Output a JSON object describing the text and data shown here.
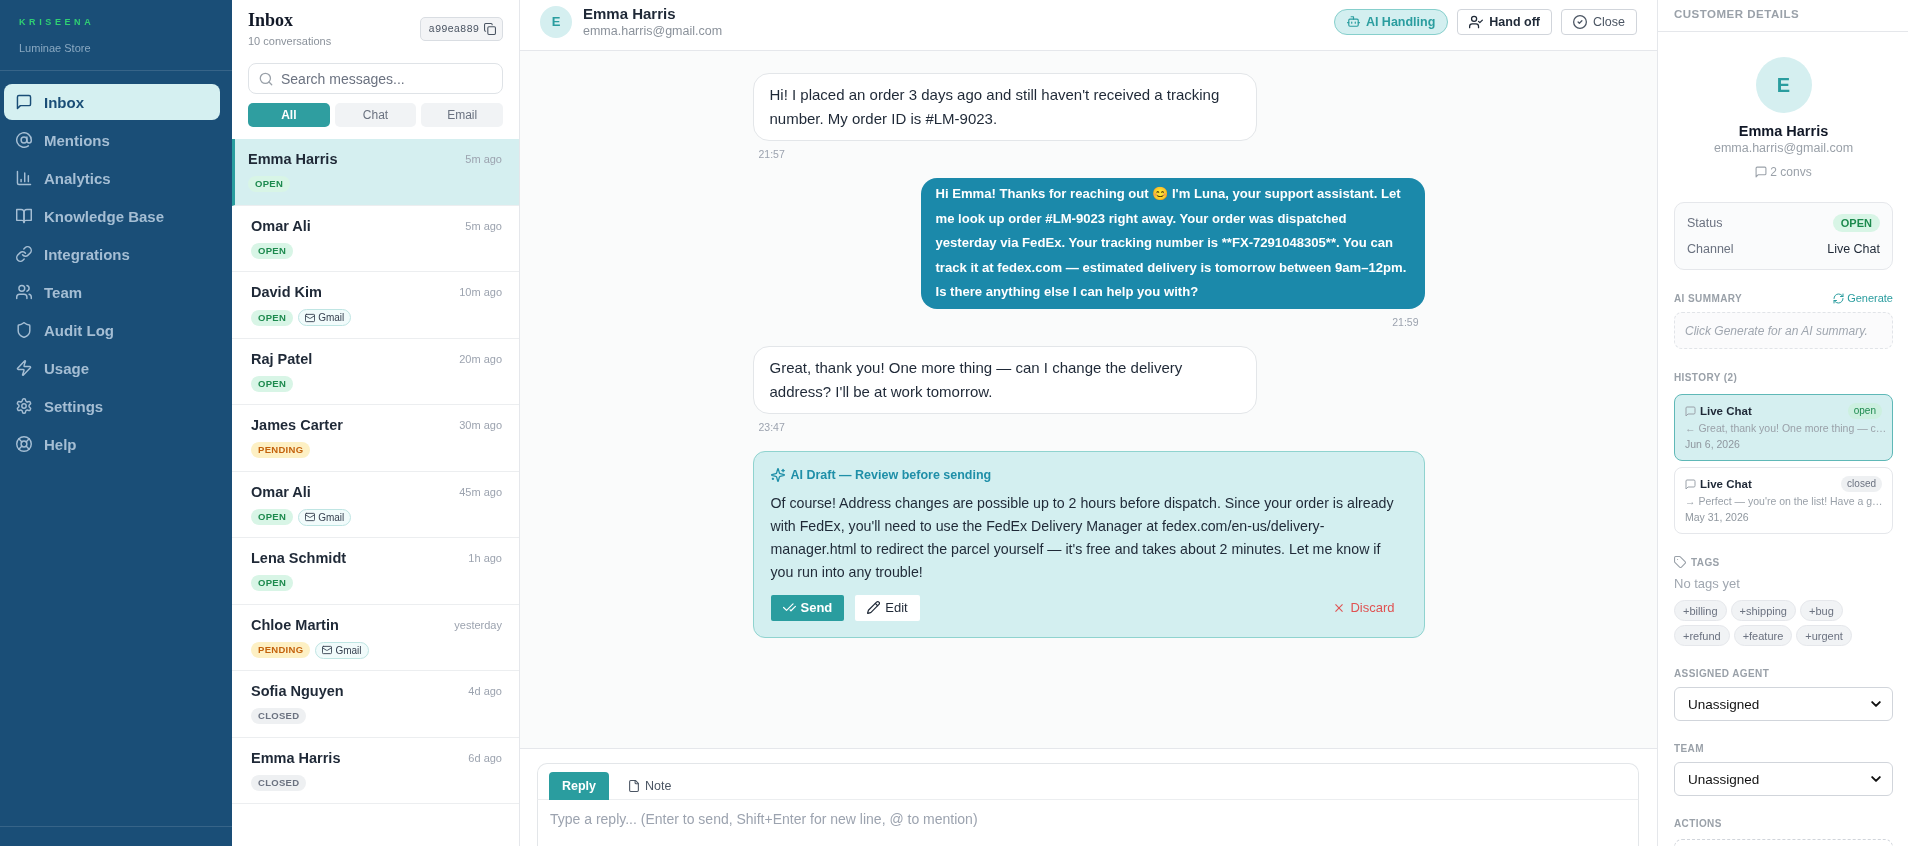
{
  "sidebar": {
    "logo": "KRISEENA",
    "store": "Luminae Store",
    "items": [
      {
        "label": "Inbox",
        "selected": true
      },
      {
        "label": "Mentions",
        "selected": false
      },
      {
        "label": "Analytics",
        "selected": false
      },
      {
        "label": "Knowledge Base",
        "selected": false
      },
      {
        "label": "Integrations",
        "selected": false
      },
      {
        "label": "Team",
        "selected": false
      },
      {
        "label": "Audit Log",
        "selected": false
      },
      {
        "label": "Usage",
        "selected": false
      },
      {
        "label": "Settings",
        "selected": false
      },
      {
        "label": "Help",
        "selected": false
      }
    ]
  },
  "inbox": {
    "title": "Inbox",
    "count": "10 conversations",
    "workspace_id": "a99ea889",
    "search": {
      "placeholder": "Search messages..."
    },
    "filters": [
      {
        "label": "All",
        "selected": true
      },
      {
        "label": "Chat",
        "selected": false
      },
      {
        "label": "Email",
        "selected": false
      }
    ],
    "conversations": [
      {
        "name": "Emma Harris",
        "time": "5m ago",
        "status": {
          "label": "OPEN",
          "kind": "open"
        },
        "selected": true
      },
      {
        "name": "Omar Ali",
        "time": "5m ago",
        "status": {
          "label": "OPEN",
          "kind": "open"
        },
        "selected": false
      },
      {
        "name": "David Kim",
        "time": "10m ago",
        "status": {
          "label": "OPEN",
          "kind": "open"
        },
        "channel": "Gmail",
        "selected": false
      },
      {
        "name": "Raj Patel",
        "time": "20m ago",
        "status": {
          "label": "OPEN",
          "kind": "open"
        },
        "selected": false
      },
      {
        "name": "James Carter",
        "time": "30m ago",
        "status": {
          "label": "PENDING",
          "kind": "pending"
        },
        "selected": false
      },
      {
        "name": "Omar Ali",
        "time": "45m ago",
        "status": {
          "label": "OPEN",
          "kind": "open"
        },
        "channel": "Gmail",
        "selected": false
      },
      {
        "name": "Lena Schmidt",
        "time": "1h ago",
        "status": {
          "label": "OPEN",
          "kind": "open"
        },
        "selected": false
      },
      {
        "name": "Chloe Martin",
        "time": "yesterday",
        "status": {
          "label": "PENDING",
          "kind": "pending"
        },
        "channel": "Gmail",
        "selected": false
      },
      {
        "name": "Sofia Nguyen",
        "time": "4d ago",
        "status": {
          "label": "CLOSED",
          "kind": "closed"
        },
        "selected": false
      },
      {
        "name": "Emma Harris",
        "time": "6d ago",
        "status": {
          "label": "CLOSED",
          "kind": "closed"
        },
        "selected": false
      }
    ]
  },
  "conversation": {
    "avatar": "E",
    "name": "Emma Harris",
    "email": "emma.harris@gmail.com",
    "actions": [
      {
        "label": "AI Handling",
        "kind": "ai"
      },
      {
        "label": "Hand off",
        "kind": "handoff"
      },
      {
        "label": "Close",
        "kind": "close"
      }
    ],
    "messages": [
      {
        "kind": "incoming",
        "text": "Hi! I placed an order 3 days ago and still haven't received a tracking number. My order ID is #LM-9023.",
        "time": "21:57"
      },
      {
        "kind": "outgoing",
        "text": "Hi Emma! Thanks for reaching out 😊 I'm Luna, your support assistant. Let me look up order #LM-9023 right away. Your order was dispatched yesterday via FedEx. Your tracking number is **FX-7291048305**. You can track it at fedex.com — estimated delivery is tomorrow between 9am–12pm. Is there anything else I can help you with?",
        "time": "21:59"
      },
      {
        "kind": "incoming",
        "text": "Great, thank you! One more thing — can I change the delivery address? I'll be at work tomorrow.",
        "time": "23:47"
      }
    ],
    "draft": {
      "title": "AI Draft — Review before sending",
      "text": "Of course! Address changes are possible up to 2 hours before dispatch. Since your order is already with FedEx, you'll need to use the FedEx Delivery Manager at fedex.com/en-us/delivery-manager.html to redirect the parcel yourself — it's free and takes about 2 minutes. Let me know if you run into any trouble!",
      "actions": [
        {
          "label": "Send",
          "kind": "send"
        },
        {
          "label": "Edit",
          "kind": "edit"
        },
        {
          "label": "Discard",
          "kind": "discard"
        }
      ]
    },
    "composer": {
      "tabs": [
        {
          "label": "Reply",
          "kind": "reply",
          "selected": true
        },
        {
          "label": "Note",
          "kind": "note",
          "selected": false
        }
      ],
      "placeholder": "Type a reply... (Enter to send, Shift+Enter for new line, @ to mention)"
    }
  },
  "customer": {
    "title": "CUSTOMER DETAILS",
    "avatar": "E",
    "name": "Emma Harris",
    "email": "emma.harris@gmail.com",
    "conversations": "2 convs",
    "fields": [
      {
        "label": "Status",
        "value": "OPEN",
        "kind": "badge"
      },
      {
        "label": "Channel",
        "value": "Live Chat",
        "kind": "text"
      }
    ],
    "summary": {
      "label": "AI SUMMARY",
      "action": "Generate",
      "hint": "Click Generate for an AI summary."
    },
    "history": {
      "label": "HISTORY (2)",
      "items": [
        {
          "channel": "Live Chat",
          "status": {
            "label": "open",
            "kind": "open"
          },
          "preview": "← Great, thank you! One more thing — c…",
          "date": "Jun 6, 2026",
          "selected": true
        },
        {
          "channel": "Live Chat",
          "status": {
            "label": "closed",
            "kind": "closed"
          },
          "preview": "→ Perfect — you're on the list! Have a g…",
          "date": "May 31, 2026",
          "selected": false
        }
      ]
    },
    "tags": {
      "label": "TAGS",
      "empty": "No tags yet",
      "suggestions": [
        "+billing",
        "+shipping",
        "+bug",
        "+refund",
        "+feature",
        "+urgent"
      ]
    },
    "assigned_agent": {
      "label": "ASSIGNED AGENT",
      "value": "Unassigned"
    },
    "team": {
      "label": "TEAM",
      "value": "Unassigned"
    },
    "actions": {
      "label": "ACTIONS"
    }
  }
}
